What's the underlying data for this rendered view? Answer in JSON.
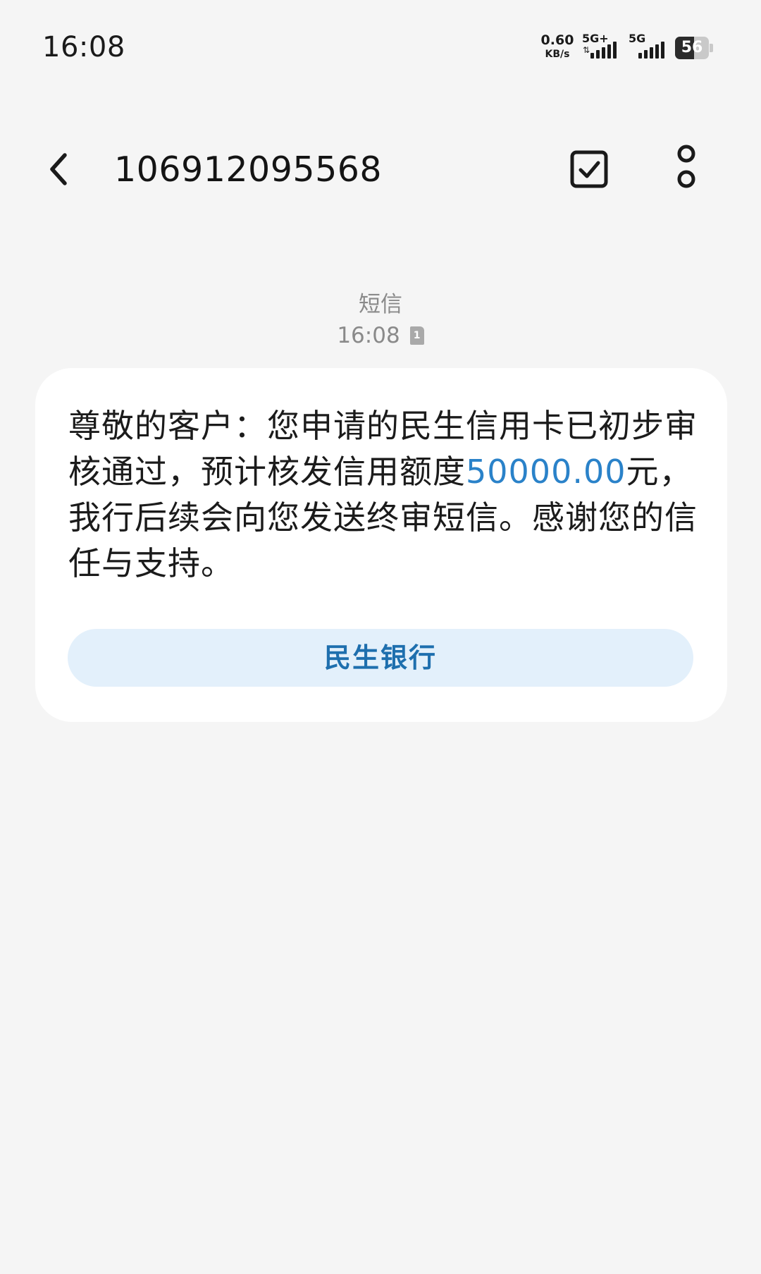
{
  "status_bar": {
    "time": "16:08",
    "net_speed_value": "0.60",
    "net_speed_unit": "KB/s",
    "sim1_label": "5G+",
    "sim2_label": "5G",
    "battery_level": "56",
    "battery_fill_fraction": 0.56
  },
  "header": {
    "title": "106912095568",
    "back_icon": "chevron-left-icon",
    "mark_read_icon": "checkbox-check-icon",
    "more_icon": "vertical-dots-icon"
  },
  "message": {
    "type_label": "短信",
    "time": "16:08",
    "sim_badge": "1",
    "body_before": "尊敬的客户：您申请的民生信用卡已初步审核通过，预计核发信用额度",
    "body_amount": "50000.00",
    "body_after": "元，我行后续会向您发送终审短信。感谢您的信任与支持。",
    "sender_button": "民生银行"
  },
  "colors": {
    "background": "#f5f5f5",
    "bubble": "#ffffff",
    "amount_link": "#2a82c9",
    "sender_button_bg": "#e3f0fb",
    "sender_button_text": "#1e6fae"
  }
}
